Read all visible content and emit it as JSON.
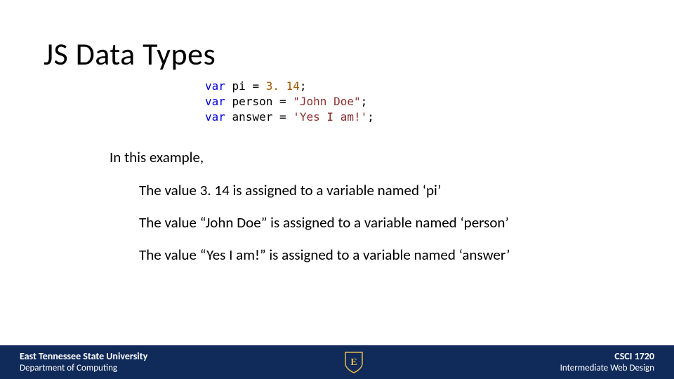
{
  "title": "JS Data Types",
  "code": {
    "lines": [
      {
        "kw": "var",
        "ident": "pi",
        "op": "=",
        "value_type": "num",
        "value": "3. 14",
        "semi": ";"
      },
      {
        "kw": "var",
        "ident": "person",
        "op": "=",
        "value_type": "str",
        "value": "\"John Doe\"",
        "semi": ";"
      },
      {
        "kw": "var",
        "ident": "answer",
        "op": "=",
        "value_type": "str",
        "value": "'Yes I am!'",
        "semi": ";"
      }
    ]
  },
  "intro": "In this example,",
  "bullets": [
    "The value 3. 14 is assigned to a variable named ‘pi’",
    "The value “John Doe” is assigned to a variable named ‘person’",
    "The value “Yes I am!” is assigned to a variable named ‘answer’"
  ],
  "footer": {
    "left1": "East Tennessee State University",
    "left2": "Department of Computing",
    "right1": "CSCI 1720",
    "right2": "Intermediate Web Design",
    "shield_letter": "E"
  }
}
